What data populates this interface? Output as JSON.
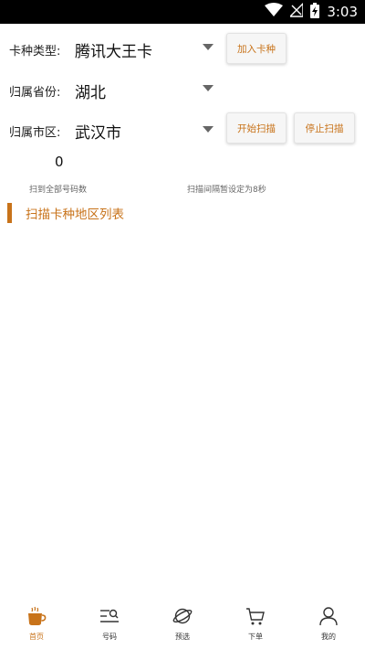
{
  "status_bar": {
    "time": "3:03"
  },
  "form": {
    "card_type": {
      "label": "卡种类型:",
      "value": "腾讯大王卡"
    },
    "province": {
      "label": "归属省份:",
      "value": "湖北"
    },
    "city": {
      "label": "归属市区:",
      "value": "武汉市"
    }
  },
  "buttons": {
    "add_card": "加入卡种",
    "start_scan": "开始扫描",
    "stop_scan": "停止扫描"
  },
  "stats": {
    "count": "0",
    "count_label": "扫到全部号码数",
    "interval_label": "扫描间隔暂设定为8秒"
  },
  "section": {
    "title": "扫描卡种地区列表"
  },
  "tabbar": {
    "items": [
      {
        "label": "首页",
        "icon": "coffee-cup-icon",
        "active": true
      },
      {
        "label": "号码",
        "icon": "number-search-icon",
        "active": false
      },
      {
        "label": "预选",
        "icon": "planet-icon",
        "active": false
      },
      {
        "label": "下单",
        "icon": "cart-icon",
        "active": false
      },
      {
        "label": "我的",
        "icon": "user-icon",
        "active": false
      }
    ]
  },
  "colors": {
    "accent": "#c8731a",
    "status_bar": "#000000"
  }
}
